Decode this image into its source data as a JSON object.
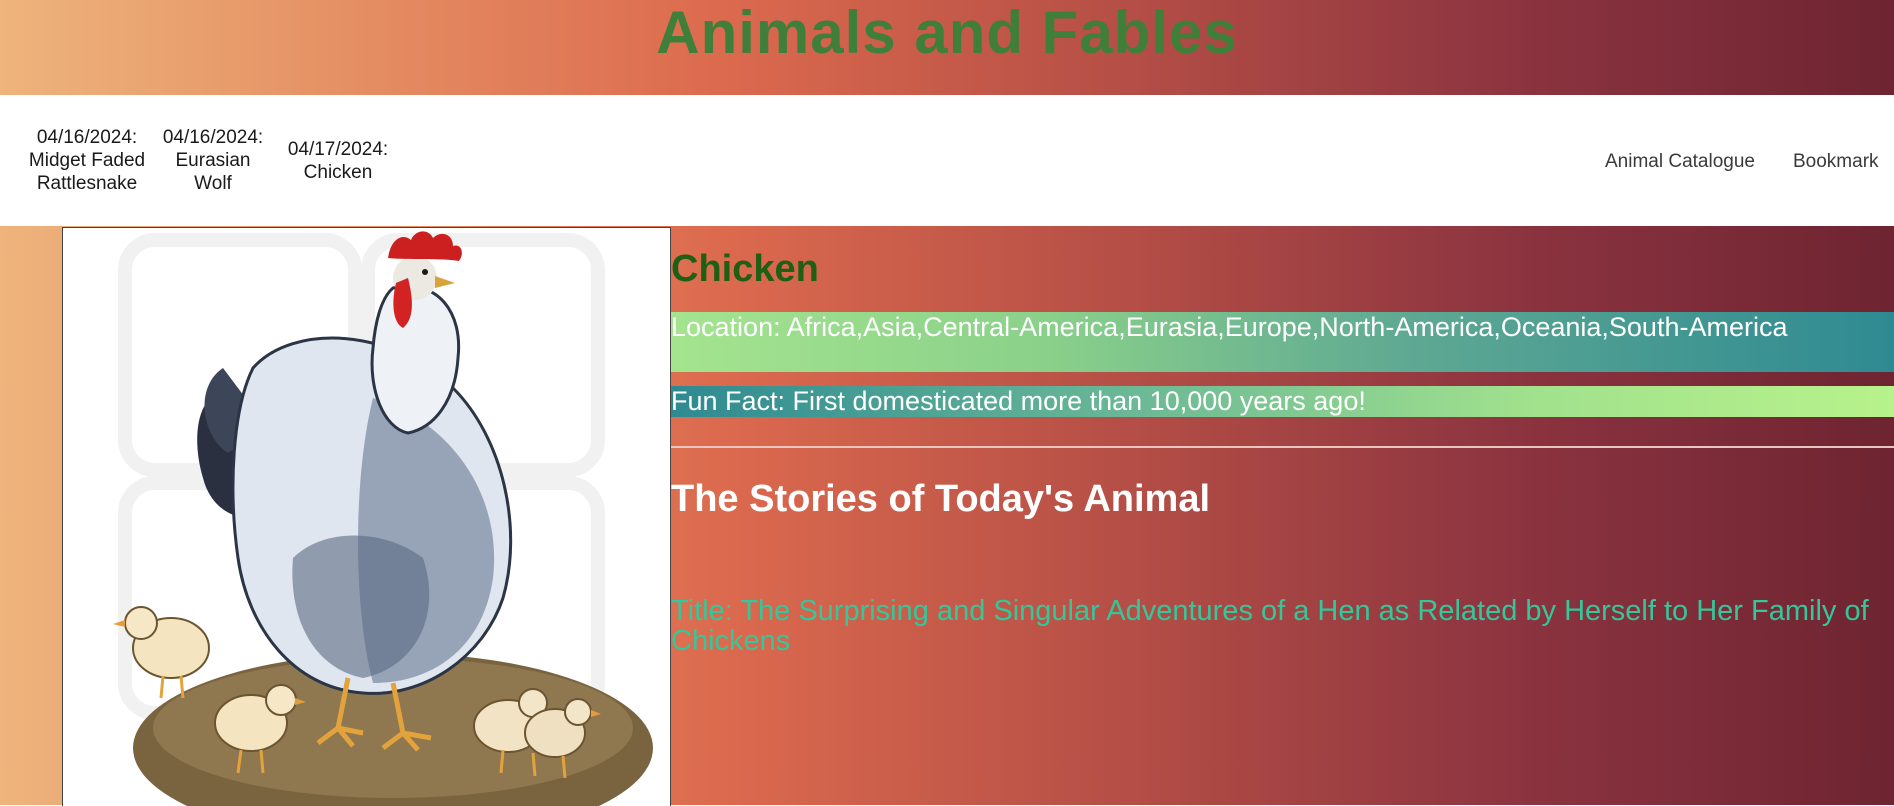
{
  "site": {
    "title": "Animals and Fables"
  },
  "recent": [
    {
      "date": "04/16/2024:",
      "name": "Midget Faded Rattlesnake"
    },
    {
      "date": "04/16/2024:",
      "name": "Eurasian Wolf"
    },
    {
      "date": "04/17/2024:",
      "name": "Chicken"
    }
  ],
  "nav": {
    "catalogue": "Animal Catalogue",
    "bookmark": "Bookmark"
  },
  "animal": {
    "name": "Chicken",
    "location": "Location: Africa,Asia,Central-America,Eurasia,Europe,North-America,Oceania,South-America",
    "fun_fact": "Fun Fact: First domesticated more than 10,000 years ago!"
  },
  "stories": {
    "heading": "The Stories of Today's Animal",
    "title": "Title: The Surprising and Singular Adventures of a Hen as Related by Herself to Her Family of Chickens"
  },
  "colors": {
    "site_title": "#3f7f3a",
    "animal_name": "#1f5f14",
    "story_title": "#35c79a"
  }
}
